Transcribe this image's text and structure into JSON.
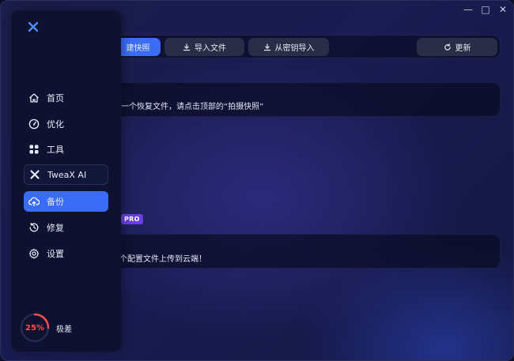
{
  "window_controls": {
    "minimize": "—",
    "maximize": "□",
    "close": "✕"
  },
  "toolbar": {
    "snapshot_label": "建快照",
    "import_file_label": "导入文件",
    "import_from_key_label": "从密钥导入",
    "update_label": "更新"
  },
  "cards": {
    "restore_message": "一个恢复文件，请点击顶部的“拍摄快照”",
    "cloud_message": "个配置文件上传到云端！",
    "pro_badge": "PRO"
  },
  "sidebar": {
    "items": [
      {
        "label": "首页",
        "icon": "home-icon"
      },
      {
        "label": "优化",
        "icon": "gauge-icon"
      },
      {
        "label": "工具",
        "icon": "grid-icon"
      },
      {
        "label": "TweaX AI",
        "icon": "tweax-logo-icon"
      },
      {
        "label": "备份",
        "icon": "cloud-upload-icon"
      },
      {
        "label": "修复",
        "icon": "history-icon"
      },
      {
        "label": "设置",
        "icon": "gear-icon"
      }
    ],
    "active_item": "备份",
    "status": {
      "percent": 25,
      "percent_text": "25%",
      "label": "极差"
    }
  },
  "colors": {
    "accent": "#3b6cf6",
    "pro_badge": "#6a3fe0",
    "status_bad": "#ff4d4d"
  }
}
